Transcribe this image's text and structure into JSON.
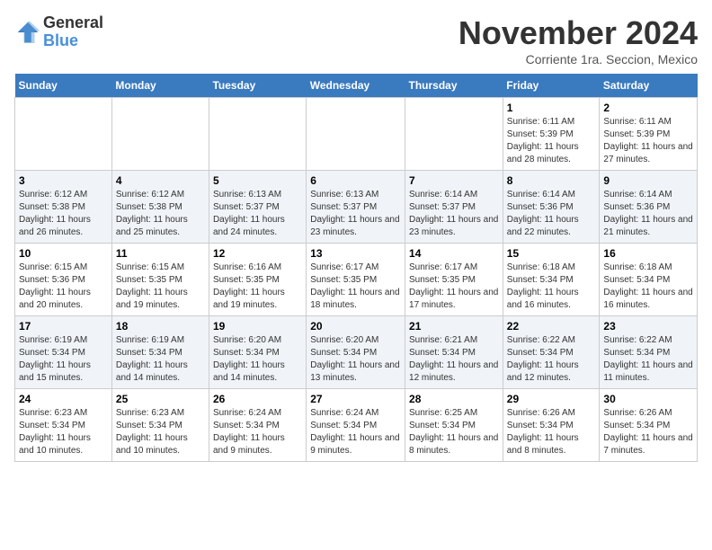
{
  "header": {
    "logo_general": "General",
    "logo_blue": "Blue",
    "month_title": "November 2024",
    "location": "Corriente 1ra. Seccion, Mexico"
  },
  "days_of_week": [
    "Sunday",
    "Monday",
    "Tuesday",
    "Wednesday",
    "Thursday",
    "Friday",
    "Saturday"
  ],
  "weeks": [
    [
      {
        "day": "",
        "info": ""
      },
      {
        "day": "",
        "info": ""
      },
      {
        "day": "",
        "info": ""
      },
      {
        "day": "",
        "info": ""
      },
      {
        "day": "",
        "info": ""
      },
      {
        "day": "1",
        "info": "Sunrise: 6:11 AM\nSunset: 5:39 PM\nDaylight: 11 hours and 28 minutes."
      },
      {
        "day": "2",
        "info": "Sunrise: 6:11 AM\nSunset: 5:39 PM\nDaylight: 11 hours and 27 minutes."
      }
    ],
    [
      {
        "day": "3",
        "info": "Sunrise: 6:12 AM\nSunset: 5:38 PM\nDaylight: 11 hours and 26 minutes."
      },
      {
        "day": "4",
        "info": "Sunrise: 6:12 AM\nSunset: 5:38 PM\nDaylight: 11 hours and 25 minutes."
      },
      {
        "day": "5",
        "info": "Sunrise: 6:13 AM\nSunset: 5:37 PM\nDaylight: 11 hours and 24 minutes."
      },
      {
        "day": "6",
        "info": "Sunrise: 6:13 AM\nSunset: 5:37 PM\nDaylight: 11 hours and 23 minutes."
      },
      {
        "day": "7",
        "info": "Sunrise: 6:14 AM\nSunset: 5:37 PM\nDaylight: 11 hours and 23 minutes."
      },
      {
        "day": "8",
        "info": "Sunrise: 6:14 AM\nSunset: 5:36 PM\nDaylight: 11 hours and 22 minutes."
      },
      {
        "day": "9",
        "info": "Sunrise: 6:14 AM\nSunset: 5:36 PM\nDaylight: 11 hours and 21 minutes."
      }
    ],
    [
      {
        "day": "10",
        "info": "Sunrise: 6:15 AM\nSunset: 5:36 PM\nDaylight: 11 hours and 20 minutes."
      },
      {
        "day": "11",
        "info": "Sunrise: 6:15 AM\nSunset: 5:35 PM\nDaylight: 11 hours and 19 minutes."
      },
      {
        "day": "12",
        "info": "Sunrise: 6:16 AM\nSunset: 5:35 PM\nDaylight: 11 hours and 19 minutes."
      },
      {
        "day": "13",
        "info": "Sunrise: 6:17 AM\nSunset: 5:35 PM\nDaylight: 11 hours and 18 minutes."
      },
      {
        "day": "14",
        "info": "Sunrise: 6:17 AM\nSunset: 5:35 PM\nDaylight: 11 hours and 17 minutes."
      },
      {
        "day": "15",
        "info": "Sunrise: 6:18 AM\nSunset: 5:34 PM\nDaylight: 11 hours and 16 minutes."
      },
      {
        "day": "16",
        "info": "Sunrise: 6:18 AM\nSunset: 5:34 PM\nDaylight: 11 hours and 16 minutes."
      }
    ],
    [
      {
        "day": "17",
        "info": "Sunrise: 6:19 AM\nSunset: 5:34 PM\nDaylight: 11 hours and 15 minutes."
      },
      {
        "day": "18",
        "info": "Sunrise: 6:19 AM\nSunset: 5:34 PM\nDaylight: 11 hours and 14 minutes."
      },
      {
        "day": "19",
        "info": "Sunrise: 6:20 AM\nSunset: 5:34 PM\nDaylight: 11 hours and 14 minutes."
      },
      {
        "day": "20",
        "info": "Sunrise: 6:20 AM\nSunset: 5:34 PM\nDaylight: 11 hours and 13 minutes."
      },
      {
        "day": "21",
        "info": "Sunrise: 6:21 AM\nSunset: 5:34 PM\nDaylight: 11 hours and 12 minutes."
      },
      {
        "day": "22",
        "info": "Sunrise: 6:22 AM\nSunset: 5:34 PM\nDaylight: 11 hours and 12 minutes."
      },
      {
        "day": "23",
        "info": "Sunrise: 6:22 AM\nSunset: 5:34 PM\nDaylight: 11 hours and 11 minutes."
      }
    ],
    [
      {
        "day": "24",
        "info": "Sunrise: 6:23 AM\nSunset: 5:34 PM\nDaylight: 11 hours and 10 minutes."
      },
      {
        "day": "25",
        "info": "Sunrise: 6:23 AM\nSunset: 5:34 PM\nDaylight: 11 hours and 10 minutes."
      },
      {
        "day": "26",
        "info": "Sunrise: 6:24 AM\nSunset: 5:34 PM\nDaylight: 11 hours and 9 minutes."
      },
      {
        "day": "27",
        "info": "Sunrise: 6:24 AM\nSunset: 5:34 PM\nDaylight: 11 hours and 9 minutes."
      },
      {
        "day": "28",
        "info": "Sunrise: 6:25 AM\nSunset: 5:34 PM\nDaylight: 11 hours and 8 minutes."
      },
      {
        "day": "29",
        "info": "Sunrise: 6:26 AM\nSunset: 5:34 PM\nDaylight: 11 hours and 8 minutes."
      },
      {
        "day": "30",
        "info": "Sunrise: 6:26 AM\nSunset: 5:34 PM\nDaylight: 11 hours and 7 minutes."
      }
    ]
  ]
}
